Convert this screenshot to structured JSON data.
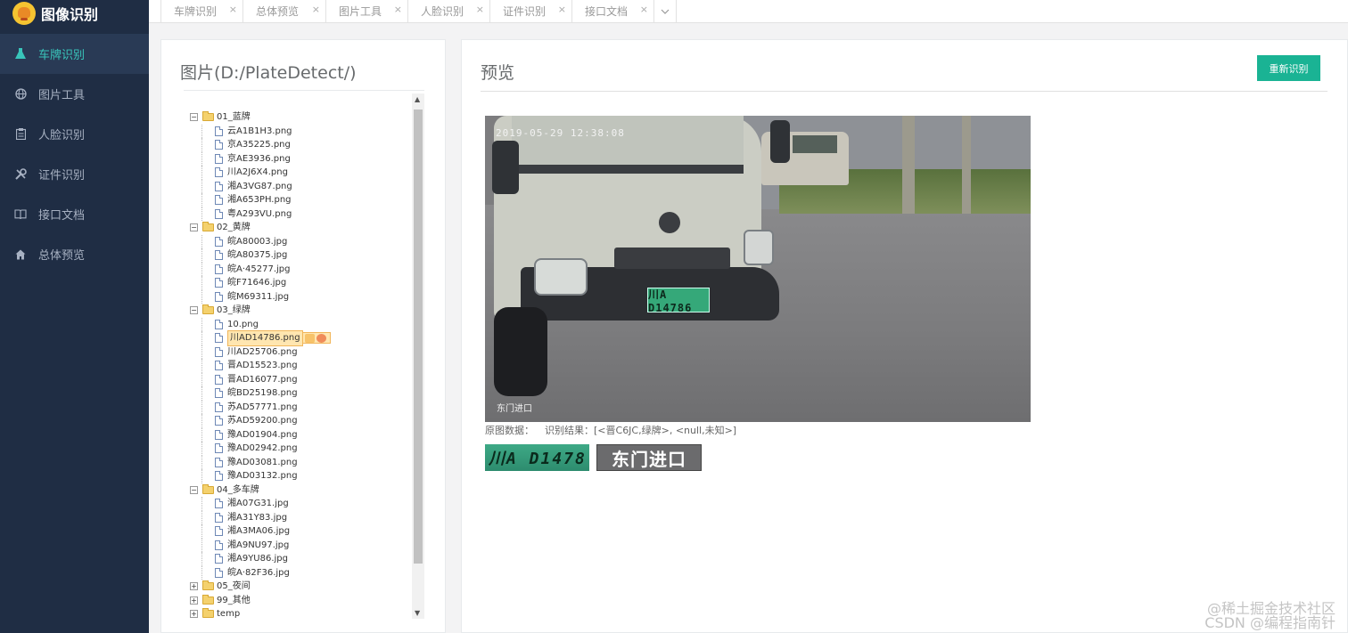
{
  "app": {
    "title": "图像识别"
  },
  "sidebar": {
    "items": [
      {
        "label": "车牌识别",
        "icon": "flask-icon",
        "active": true
      },
      {
        "label": "图片工具",
        "icon": "globe-icon",
        "active": false
      },
      {
        "label": "人脸识别",
        "icon": "clipboard-icon",
        "active": false
      },
      {
        "label": "证件识别",
        "icon": "tools-icon",
        "active": false
      },
      {
        "label": "接口文档",
        "icon": "book-icon",
        "active": false
      },
      {
        "label": "总体预览",
        "icon": "home-icon",
        "active": false
      }
    ]
  },
  "tabs": [
    {
      "label": "车牌识别"
    },
    {
      "label": "总体预览"
    },
    {
      "label": "图片工具"
    },
    {
      "label": "人脸识别"
    },
    {
      "label": "证件识别"
    },
    {
      "label": "接口文档"
    }
  ],
  "left_panel": {
    "title": "图片(D:/PlateDetect/)",
    "tree": [
      {
        "folder": "01_蓝牌",
        "expanded": true,
        "files": [
          "云A1B1H3.png",
          "京A35225.png",
          "京AE3936.png",
          "川A2J6X4.png",
          "湘A3VG87.png",
          "湘A653PH.png",
          "粤A293VU.png"
        ]
      },
      {
        "folder": "02_黄牌",
        "expanded": true,
        "files": [
          "皖A80003.jpg",
          "皖A80375.jpg",
          "皖A·45277.jpg",
          "皖F71646.jpg",
          "皖M69311.jpg"
        ]
      },
      {
        "folder": "03_绿牌",
        "expanded": true,
        "files": [
          "10.png",
          "川AD14786.png",
          "川AD25706.png",
          "晋AD15523.png",
          "晋AD16077.png",
          "皖BD25198.png",
          "苏AD57771.png",
          "苏AD59200.png",
          "豫AD01904.png",
          "豫AD02942.png",
          "豫AD03081.png",
          "豫AD03132.png"
        ]
      },
      {
        "folder": "04_多车牌",
        "expanded": true,
        "files": [
          "湘A07G31.jpg",
          "湘A31Y83.jpg",
          "湘A3MA06.jpg",
          "湘A9NU97.jpg",
          "湘A9YU86.jpg",
          "皖A·82F36.jpg"
        ]
      },
      {
        "folder": "05_夜间",
        "expanded": false,
        "files": []
      },
      {
        "folder": "99_其他",
        "expanded": false,
        "files": []
      },
      {
        "folder": "temp",
        "expanded": false,
        "files": []
      }
    ],
    "selected_file": "川AD14786.png"
  },
  "preview": {
    "title": "预览",
    "rerecognize_label": "重新识别",
    "photo": {
      "timestamp": "2019-05-29 12:38:08",
      "caption": "东门进口",
      "plate": "川A D14786"
    },
    "result": {
      "source_label": "原图数据：",
      "result_label": "识别结果：",
      "result_value": "[<晋C6JC,绿牌>, <null,未知>]"
    },
    "crops": {
      "plate_text": "川A D1478",
      "caption_text": "东门进口"
    }
  },
  "watermark": {
    "line1": "@稀土掘金技术社区",
    "line2": "CSDN @编程指南针"
  },
  "colors": {
    "sidebar_bg": "#1f2d44",
    "accent": "#1ab394",
    "active_nav": "#39c5bb",
    "selected_file": "#ffe6b0"
  }
}
